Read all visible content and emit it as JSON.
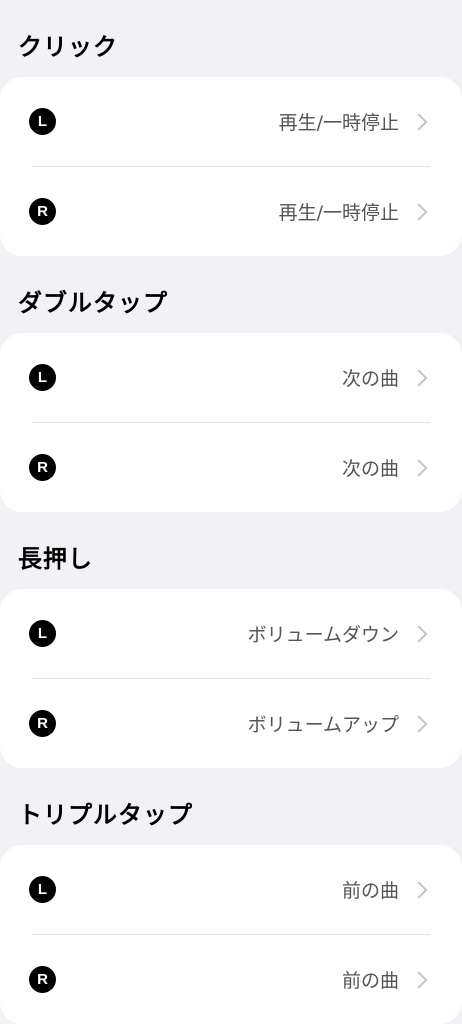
{
  "sections": [
    {
      "title": "クリック",
      "left": {
        "side": "L",
        "action": "再生/一時停止"
      },
      "right": {
        "side": "R",
        "action": "再生/一時停止"
      }
    },
    {
      "title": "ダブルタップ",
      "left": {
        "side": "L",
        "action": "次の曲"
      },
      "right": {
        "side": "R",
        "action": "次の曲"
      }
    },
    {
      "title": "長押し",
      "left": {
        "side": "L",
        "action": "ボリュームダウン"
      },
      "right": {
        "side": "R",
        "action": "ボリュームアップ"
      }
    },
    {
      "title": "トリプルタップ",
      "left": {
        "side": "L",
        "action": "前の曲"
      },
      "right": {
        "side": "R",
        "action": "前の曲"
      }
    }
  ],
  "icons": {
    "row_chevron": "chevron-right-icon"
  }
}
